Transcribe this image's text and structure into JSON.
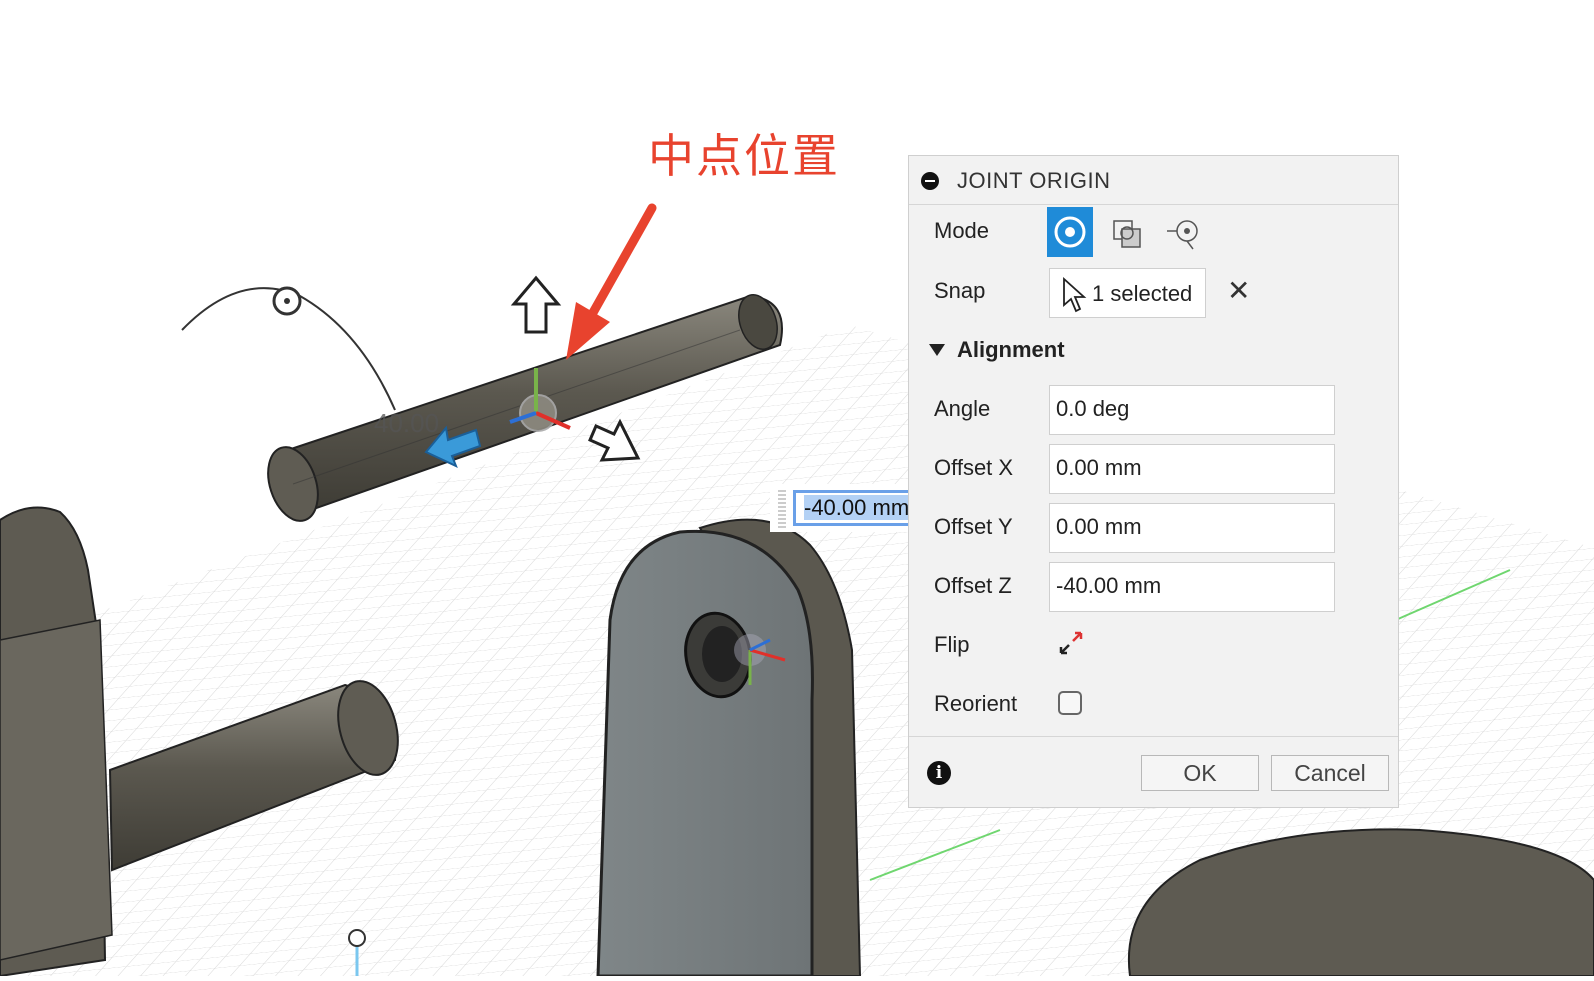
{
  "annotation": {
    "text": "中点位置"
  },
  "viewport": {
    "dimension_label": "40.00"
  },
  "floating_input": {
    "value": "-40.00 mm"
  },
  "dialog": {
    "title": "JOINT ORIGIN",
    "mode": {
      "label": "Mode",
      "options": [
        "simple-origin-icon",
        "between-two-faces-icon",
        "offset-origin-icon"
      ],
      "active_index": 0
    },
    "snap": {
      "label": "Snap",
      "value": "1 selected"
    },
    "alignment": {
      "title": "Alignment"
    },
    "fields": {
      "angle": {
        "label": "Angle",
        "value": "0.0 deg"
      },
      "offset_x": {
        "label": "Offset X",
        "value": "0.00 mm"
      },
      "offset_y": {
        "label": "Offset Y",
        "value": "0.00 mm"
      },
      "offset_z": {
        "label": "Offset Z",
        "value": "-40.00 mm"
      }
    },
    "flip": {
      "label": "Flip"
    },
    "reorient": {
      "label": "Reorient",
      "checked": false
    },
    "buttons": {
      "ok": "OK",
      "cancel": "Cancel"
    }
  },
  "colors": {
    "accent": "#1f8bd8",
    "annotation": "#e8432e",
    "model": "#5e5b52",
    "arrow_blue": "#3a9ad9"
  }
}
